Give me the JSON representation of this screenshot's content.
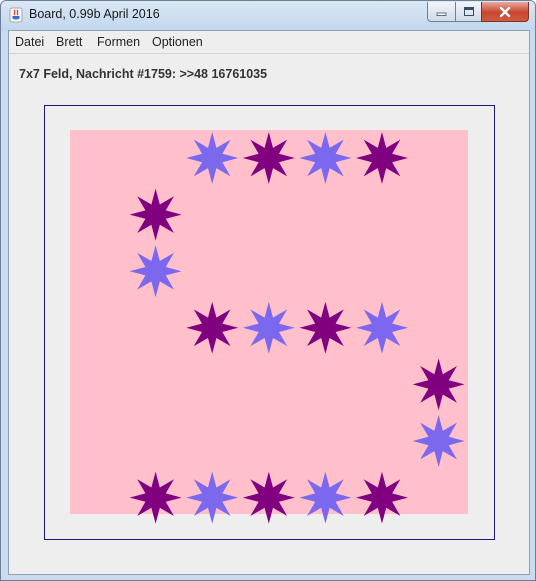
{
  "window": {
    "title": "Board, 0.99b April 2016",
    "app_icon": "java-cup-icon"
  },
  "titlebar_buttons": {
    "minimize": "minimize-icon",
    "maximize": "maximize-icon",
    "close": "close-icon"
  },
  "menu": {
    "items": [
      {
        "label": "Datei"
      },
      {
        "label": "Brett"
      },
      {
        "label": "Formen"
      },
      {
        "label": "Optionen"
      }
    ]
  },
  "status": {
    "text": "7x7 Feld, Nachricht #1759: >>48 16761035"
  },
  "board": {
    "rows": 7,
    "cols": 7,
    "background_color": "#ffc0cb",
    "colors": {
      "dark": "#800080",
      "light": "#7b68ee"
    },
    "stars": [
      {
        "row": 0,
        "col": 2,
        "color": "light"
      },
      {
        "row": 0,
        "col": 3,
        "color": "dark"
      },
      {
        "row": 0,
        "col": 4,
        "color": "light"
      },
      {
        "row": 0,
        "col": 5,
        "color": "dark"
      },
      {
        "row": 1,
        "col": 1,
        "color": "dark"
      },
      {
        "row": 2,
        "col": 1,
        "color": "light"
      },
      {
        "row": 3,
        "col": 2,
        "color": "dark"
      },
      {
        "row": 3,
        "col": 3,
        "color": "light"
      },
      {
        "row": 3,
        "col": 4,
        "color": "dark"
      },
      {
        "row": 3,
        "col": 5,
        "color": "light"
      },
      {
        "row": 4,
        "col": 6,
        "color": "dark"
      },
      {
        "row": 5,
        "col": 6,
        "color": "light"
      },
      {
        "row": 6,
        "col": 1,
        "color": "dark"
      },
      {
        "row": 6,
        "col": 2,
        "color": "light"
      },
      {
        "row": 6,
        "col": 3,
        "color": "dark"
      },
      {
        "row": 6,
        "col": 4,
        "color": "light"
      },
      {
        "row": 6,
        "col": 5,
        "color": "dark"
      }
    ]
  }
}
